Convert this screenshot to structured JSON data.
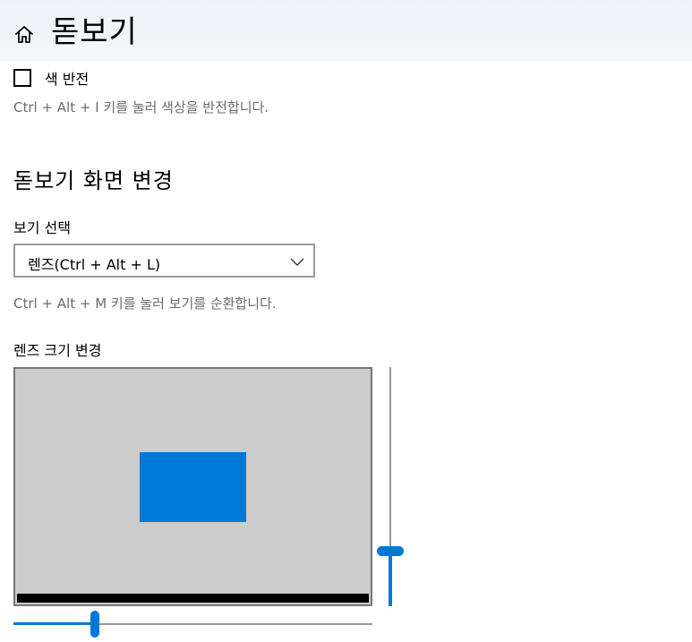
{
  "header": {
    "title": "돋보기",
    "home_icon": "home-icon"
  },
  "invert_colors": {
    "label": "색 반전",
    "checked": false,
    "hint": "Ctrl + Alt + I 키를 눌러 색상을 반전합니다."
  },
  "view_section": {
    "title": "돋보기 화면 변경",
    "view_label": "보기 선택",
    "selected_view": "렌즈(Ctrl + Alt + L)",
    "hint": "Ctrl + Alt + M 키를 눌러 보기를 순환합니다."
  },
  "lens_size": {
    "label": "렌즈 크기 변경",
    "width_fraction": 0.22,
    "height_fraction": 0.25
  },
  "colors": {
    "accent": "#0078d7",
    "preview_background": "#cccccc",
    "hint_text": "#6b6b6b"
  }
}
